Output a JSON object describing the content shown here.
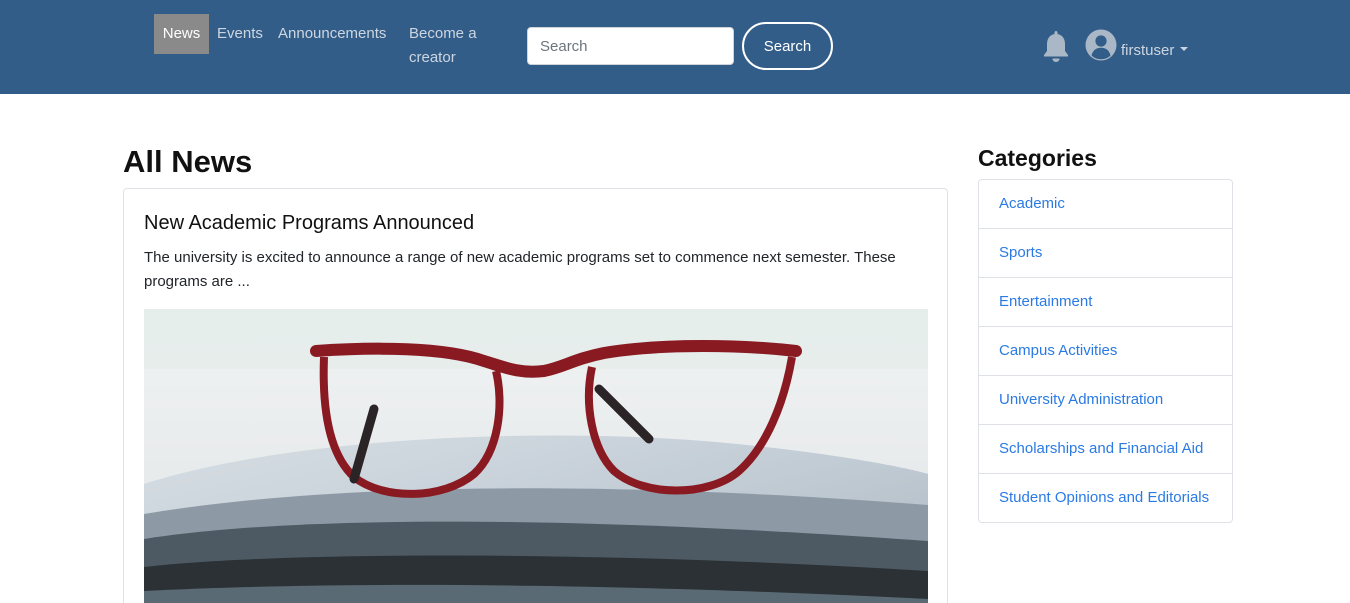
{
  "navbar": {
    "links": [
      {
        "label": "News",
        "active": true
      },
      {
        "label": "Events"
      },
      {
        "label": "Announcements"
      },
      {
        "label": "Become a creator"
      }
    ],
    "search": {
      "placeholder": "Search",
      "button_label": "Search"
    },
    "notification_icon": "bell-icon",
    "avatar_icon": "user-circle-icon",
    "username": "firstuser",
    "colors": {
      "background": "#325d88",
      "active_link_bg": "#8a8a8a"
    }
  },
  "main": {
    "title": "All News",
    "articles": [
      {
        "title": "New Academic Programs Announced",
        "excerpt": "The university is excited to announce a range of new academic programs set to commence next semester. These programs are ...",
        "image": "red eyeglasses resting on a stack of newspapers"
      }
    ]
  },
  "sidebar": {
    "title": "Categories",
    "categories": [
      "Academic",
      "Sports",
      "Entertainment",
      "Campus Activities",
      "University Administration",
      "Scholarships and Financial Aid",
      "Student Opinions and Editorials"
    ],
    "link_color": "#2a7ae4"
  }
}
